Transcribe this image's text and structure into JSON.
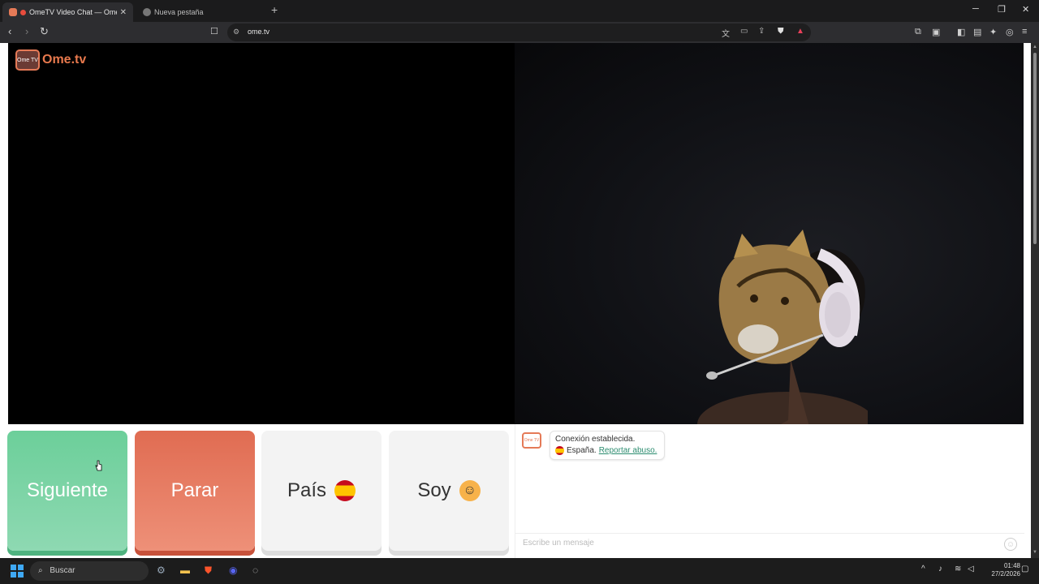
{
  "browser": {
    "tabs": [
      {
        "title": "OmeTV Video Chat — Omeg",
        "active": true
      },
      {
        "title": "Nueva pestaña",
        "active": false
      }
    ],
    "new_tab": "+",
    "url": "ome.tv",
    "window_controls": {
      "minimize": "─",
      "maximize": "❐",
      "close": "✕"
    }
  },
  "site": {
    "logo_text": "Ome.tv",
    "logo_badge": "Ome TV"
  },
  "controls": {
    "next_label": "Siguiente",
    "stop_label": "Parar",
    "country_label": "País",
    "gender_label": "Soy",
    "colors": {
      "next": "#6ccf9a",
      "stop": "#e06c52",
      "neutral": "#f3f3f3"
    }
  },
  "chat": {
    "system_line1": "Conexión establecida.",
    "country": "España.",
    "report_link": "Reportar abuso.",
    "input_placeholder": "Escribe un mensaje",
    "emoji_button": "☺"
  },
  "taskbar": {
    "search_label": "Buscar",
    "time": "01:48",
    "date": "27/2/2026"
  }
}
